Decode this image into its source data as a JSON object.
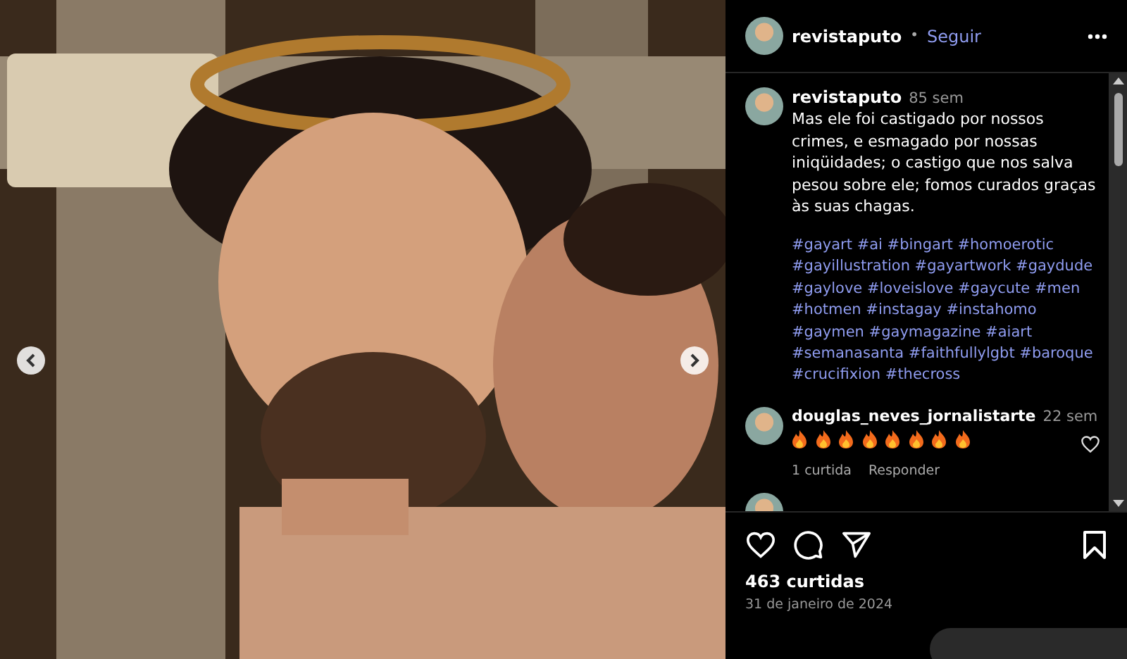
{
  "post": {
    "author": "revistaputo",
    "follow_label": "Seguir",
    "separator": "•"
  },
  "caption": {
    "author": "revistaputo",
    "time": "85 sem",
    "text": "Mas ele foi castigado por nossos crimes, e esmagado por nossas iniqüidades; o castigo que nos salva pesou sobre ele; fomos curados graças às suas chagas.",
    "hashtags": [
      "#gayart #ai #bingart #homoerotic",
      "#gayillustration #gayartwork #gaydude",
      "#gaylove #loveislove #gaycute #men",
      "#hotmen #instagay #instahomo",
      "#gaymen #gaymagazine #aiart",
      "#semanasanta #faithfullylgbt #baroque",
      "#crucifixion #thecross"
    ]
  },
  "comments": [
    {
      "author": "douglas_neves_jornalistarte",
      "time": "22 sem",
      "emojis": [
        {
          "kind": "fire"
        },
        {
          "kind": "fire"
        },
        {
          "kind": "fire"
        },
        {
          "kind": "fire"
        },
        {
          "kind": "fire"
        },
        {
          "kind": "fire"
        },
        {
          "kind": "fire"
        },
        {
          "kind": "fire"
        }
      ],
      "likes": "1 curtida",
      "reply_label": "Responder",
      "liked": false
    }
  ],
  "likes": "463 curtidas",
  "date": "31 de janeiro de 2024",
  "saved": false
}
